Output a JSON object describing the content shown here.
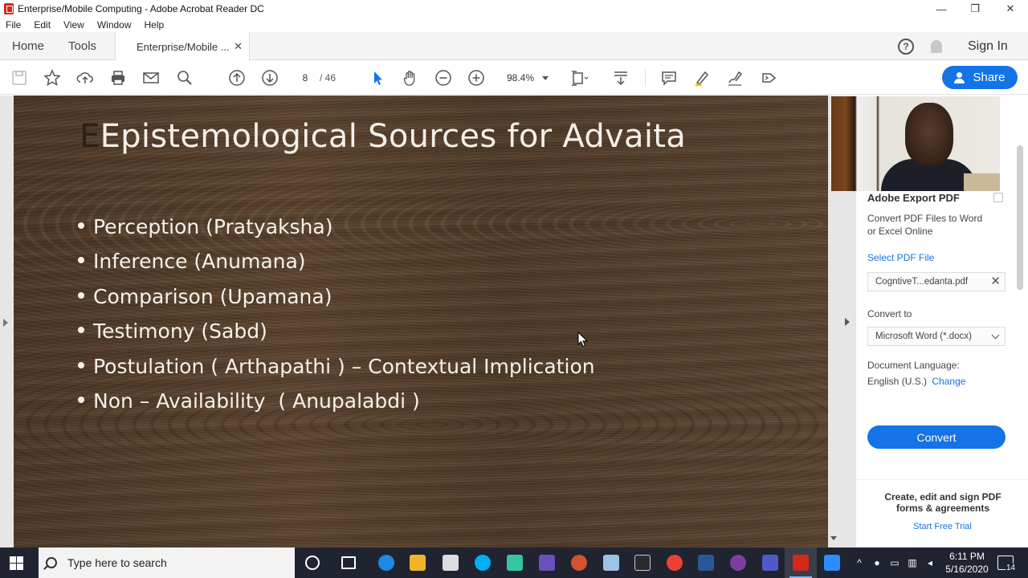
{
  "window": {
    "title": "Enterprise/Mobile Computing - Adobe Acrobat Reader DC",
    "minimize": "—",
    "maximize": "❐",
    "close": "✕"
  },
  "menu": [
    "File",
    "Edit",
    "View",
    "Window",
    "Help"
  ],
  "tabs": {
    "home": "Home",
    "tools": "Tools",
    "document": "Enterprise/Mobile ...",
    "close": "✕",
    "help": "?",
    "sign_in": "Sign In"
  },
  "toolbar": {
    "page_current": "8",
    "page_total": "/ 46",
    "zoom": "98.4%",
    "share_label": "Share"
  },
  "slide": {
    "title_ghost": "E",
    "title": "Epistemological Sources for Advaita",
    "bullets": [
      "Perception (Pratyaksha)",
      "Inference (Anumana)",
      "Comparison (Upamana)",
      "Testimony (Sabd)",
      "Postulation ( Arthapathi ) – Contextual Implication",
      "Non – Availability  ( Anupalabdi )"
    ]
  },
  "export_panel": {
    "header": "Adobe Export PDF",
    "description": "Convert PDF Files to Word or Excel Online",
    "select_file_label": "Select PDF File",
    "file_name": "CogntiveT...edanta.pdf",
    "convert_to_label": "Convert to",
    "format": "Microsoft Word (*.docx)",
    "doc_language_label": "Document Language:",
    "doc_language": "English (U.S.)",
    "change_link": "Change",
    "convert_button": "Convert",
    "promo": "Create, edit and sign PDF forms & agreements",
    "trial_link": "Start Free Trial"
  },
  "taskbar": {
    "search_placeholder": "Type here to search",
    "time": "6:11 PM",
    "date": "5/16/2020",
    "notifications": "14"
  },
  "colors": {
    "accent": "#1473e6",
    "taskbar": "#1f2430"
  }
}
